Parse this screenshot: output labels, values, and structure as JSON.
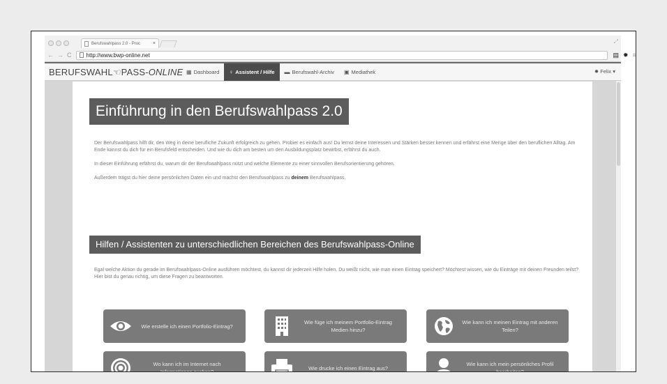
{
  "browser": {
    "tab_title": "Berufswahlpass 2.0 - Proc",
    "url": "http://www.bwp-online.net"
  },
  "navbar": {
    "brand_left": "BERUFSWAHL",
    "brand_right": "PASS-",
    "brand_online": "ONLINE",
    "items": [
      {
        "icon": "grid-icon",
        "label": "Dashboard"
      },
      {
        "icon": "bulb-icon",
        "label": "Assistent / Hilfe",
        "active": true
      },
      {
        "icon": "folder-icon",
        "label": "Berufswahl-Archiv"
      },
      {
        "icon": "image-icon",
        "label": "Mediathek"
      }
    ],
    "user_label": "Felix"
  },
  "main": {
    "title": "Einführung in den Berufswahlpass 2.0",
    "intro_p1": "Der Berufswahlpass hilft dir, den Weg in deine berufliche Zukunft erfolgreich zu gehen. Probier es einfach aus! Du lernst deine Interessen und Stärken besser kennen und erfährst eine Menge über den beruflichen Alltag. Am Ende kannst du dich für ein Berufsfeld entscheiden. Und wie du dich am besten um den Ausbildungsplatz bewirbst, erfährst du auch.",
    "intro_p2": "In dieser Einführung erfährst du, warum dir der Berufswahlpass nützt und welche Elemente zu einer sinnvollen Berufsorientierung gehören.",
    "intro_p3_before": "Außerdem trägst du hier deine persönlichen Daten ein und machst den Berufswahlpass zu ",
    "intro_p3_bold": "deinem",
    "intro_p3_after": " Berufswahlpass.",
    "subtitle": "Hilfen / Assistenten zu unterschiedlichen Bereichen des Berufswahlpass-Online",
    "help_p": "Egal welche Aktion du gerade im Berufswahlpass-Online ausführen möchtest, du kannst dir jederzeit Hilfe holen. Du weißt nicht, wie man einen Eintrag speichert? Möchtest wissen, wie du Einträge mit deinen Freunden teilst? Hier bist du genau richtig, um diese Fragen zu beantworten.",
    "help_buttons": [
      {
        "icon": "eye-icon",
        "label": "Wie erstelle ich einen Portfolio-Eintrag?"
      },
      {
        "icon": "building-icon",
        "label": "Wie füge ich meinem Portfolio-Eintrag Medien hinzu?"
      },
      {
        "icon": "globe-icon",
        "label": "Wie kann ich meinen Eintrag mit anderen Teilen?"
      },
      {
        "icon": "target-icon",
        "label": "Wo kann ich im Internet nach Informationen suchen?"
      },
      {
        "icon": "printer-icon",
        "label": "Wie drucke ich einen Eintrag aus?"
      },
      {
        "icon": "user-icon",
        "label": "Wie kann ich mein persönliches Profil bearbeiten?"
      }
    ]
  }
}
